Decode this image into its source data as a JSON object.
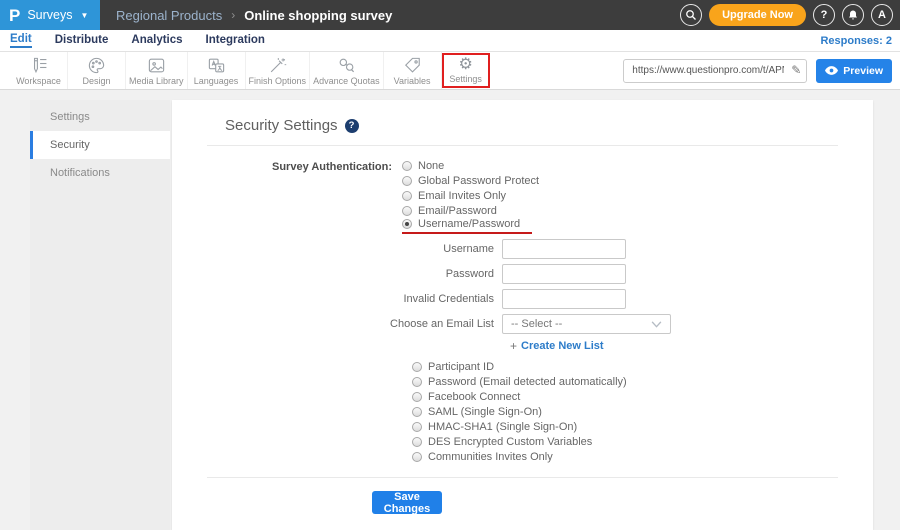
{
  "navbar": {
    "logo_text": "P",
    "product_menu_label": "Surveys",
    "breadcrumb": {
      "folder": "Regional Products",
      "separator": "›",
      "survey_title": "Online shopping survey"
    },
    "upgrade_label": "Upgrade Now",
    "help_badge": "?",
    "avatar_initial": "A"
  },
  "tabs": {
    "items": [
      "Edit",
      "Distribute",
      "Analytics",
      "Integration"
    ],
    "active": "Edit",
    "responses_label": "Responses: 2"
  },
  "toolbar": {
    "items": [
      {
        "label": "Workspace",
        "icon": "workspace-icon"
      },
      {
        "label": "Design",
        "icon": "design-icon"
      },
      {
        "label": "Media Library",
        "icon": "media-library-icon"
      },
      {
        "label": "Languages",
        "icon": "languages-icon"
      },
      {
        "label": "Finish Options",
        "icon": "finish-options-icon"
      },
      {
        "label": "Advance Quotas",
        "icon": "advance-quotas-icon"
      },
      {
        "label": "Variables",
        "icon": "variables-icon"
      },
      {
        "label": "Settings",
        "icon": "settings-gear-icon"
      }
    ],
    "active_item": "Settings",
    "url_value": "https://www.questionpro.com/t/APNrFZ",
    "preview_label": "Preview"
  },
  "sidebar": {
    "items": [
      "Settings",
      "Security",
      "Notifications"
    ],
    "active": "Security"
  },
  "security": {
    "title": "Security Settings",
    "auth_label": "Survey Authentication:",
    "options_top": [
      "None",
      "Global Password Protect",
      "Email Invites Only",
      "Email/Password",
      "Username/Password"
    ],
    "selected_option": "Username/Password",
    "fields": [
      {
        "label": "Username",
        "value": ""
      },
      {
        "label": "Password",
        "value": ""
      },
      {
        "label": "Invalid Credentials",
        "value": ""
      }
    ],
    "email_list": {
      "label": "Choose an Email List",
      "selected_value": "-- Select --"
    },
    "create_list": {
      "plus": "+",
      "text": "Create New List"
    },
    "options_bottom": [
      "Participant ID",
      "Password (Email detected automatically)",
      "Facebook Connect",
      "SAML (Single Sign-On)",
      "HMAC-SHA1 (Single Sign-On)",
      "DES Encrypted Custom Variables",
      "Communities Invites Only"
    ],
    "save_label": "Save Changes"
  },
  "colors": {
    "navbar_bg": "#3d3d3d",
    "brand_blue": "#2e95d8",
    "link_blue": "#2d7cc9",
    "button_blue": "#2080e8",
    "upgrade_orange": "#f9a41b",
    "annotation_red": "#e01f1f",
    "help_navy": "#1d3e6f"
  }
}
